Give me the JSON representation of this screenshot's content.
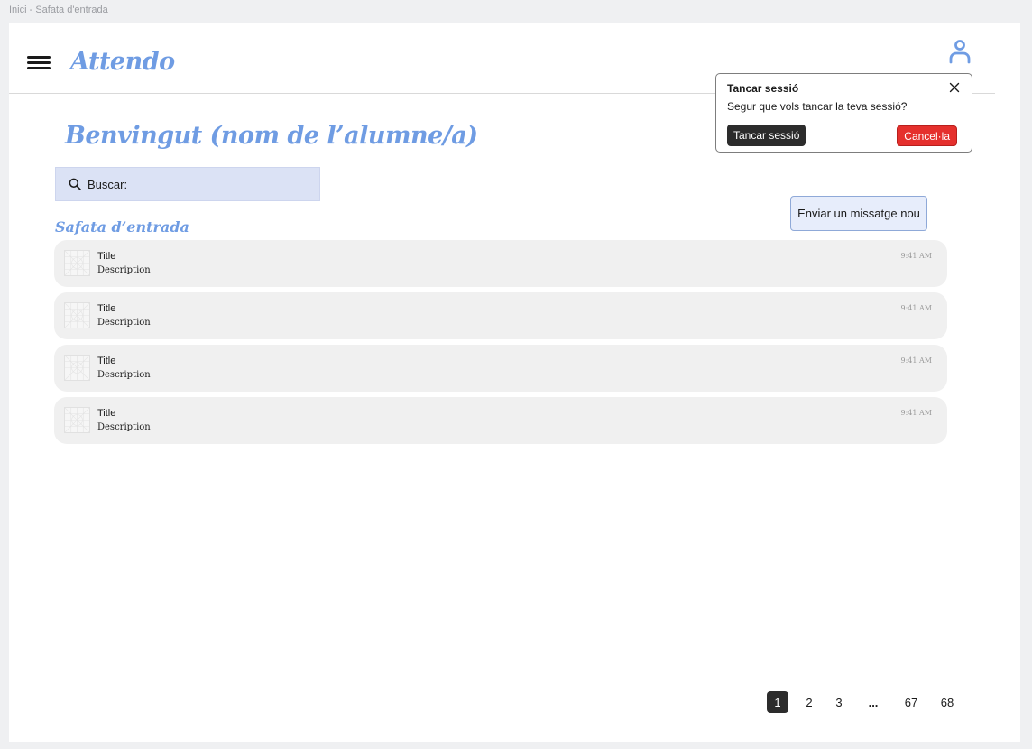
{
  "frame": {
    "caption": "Inici - Safata d'entrada"
  },
  "header": {
    "menu_icon": "hamburger-icon",
    "logo": "Attendo",
    "user_icon": "user-icon"
  },
  "welcome": "Benvingut (nom de l’alumne/a)",
  "search": {
    "icon": "search-icon",
    "label": "Buscar:"
  },
  "inbox": {
    "title": "Safata d’entrada",
    "new_message_label": "Enviar un missatge nou",
    "items": [
      {
        "title": "Title",
        "description": "Description",
        "time": "9:41 AM",
        "icon": "image-placeholder-icon"
      },
      {
        "title": "Title",
        "description": "Description",
        "time": "9:41 AM",
        "icon": "image-placeholder-icon"
      },
      {
        "title": "Title",
        "description": "Description",
        "time": "9:41 AM",
        "icon": "image-placeholder-icon"
      },
      {
        "title": "Title",
        "description": "Description",
        "time": "9:41 AM",
        "icon": "image-placeholder-icon"
      }
    ]
  },
  "logout_popup": {
    "title": "Tancar sessió",
    "message": "Segur que vols tancar la teva sessió?",
    "confirm_label": "Tancar sessió",
    "cancel_label": "Cancel·la",
    "close_icon": "close-icon"
  },
  "pagination": {
    "pages": [
      "1",
      "2",
      "3",
      "...",
      "67",
      "68"
    ],
    "current": "1"
  },
  "colors": {
    "accent": "#6f9ce3",
    "search_bg": "#dbe2f5",
    "danger": "#e5302d",
    "dark": "#2c2c2c"
  }
}
